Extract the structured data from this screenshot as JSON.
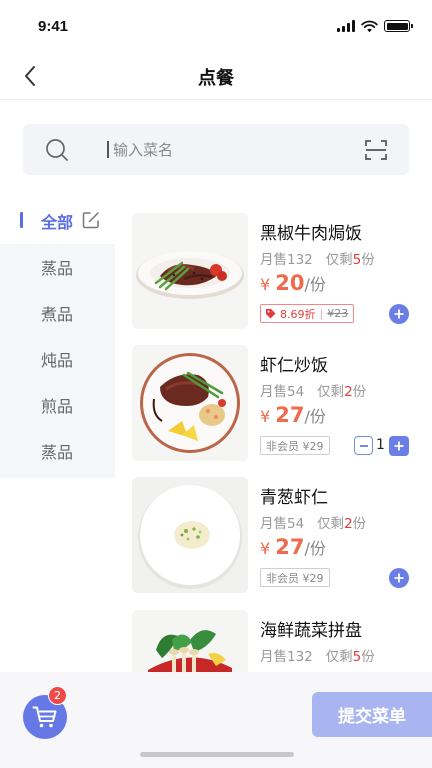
{
  "status_bar": {
    "time": "9:41"
  },
  "header": {
    "title": "点餐"
  },
  "search": {
    "placeholder": "输入菜名",
    "value": ""
  },
  "categories": [
    {
      "label": "全部",
      "active": true
    },
    {
      "label": "蒸品",
      "active": false
    },
    {
      "label": "煮品",
      "active": false
    },
    {
      "label": "炖品",
      "active": false
    },
    {
      "label": "煎品",
      "active": false
    },
    {
      "label": "蒸品",
      "active": false
    }
  ],
  "dishes": [
    {
      "name": "黑椒牛肉焗饭",
      "sold_prefix": "月售",
      "sold": "132",
      "left_prefix": "仅剩",
      "left": "5",
      "left_suffix": "份",
      "yen": "¥",
      "price": "20",
      "unit": "/份",
      "discount": "8.69折",
      "orig_price": "¥23",
      "quantity": 0
    },
    {
      "name": "虾仁炒饭",
      "sold_prefix": "月售",
      "sold": "54",
      "left_prefix": "仅剩",
      "left": "2",
      "left_suffix": "份",
      "yen": "¥",
      "price": "27",
      "unit": "/份",
      "member_tag": "非会员 ¥29",
      "quantity": 1
    },
    {
      "name": "青葱虾仁",
      "sold_prefix": "月售",
      "sold": "54",
      "left_prefix": "仅剩",
      "left": "2",
      "left_suffix": "份",
      "yen": "¥",
      "price": "27",
      "unit": "/份",
      "member_tag": "非会员 ¥29",
      "quantity": 0
    },
    {
      "name": "海鲜蔬菜拼盘",
      "sold_prefix": "月售",
      "sold": "132",
      "left_prefix": "仅剩",
      "left": "5",
      "left_suffix": "份",
      "quantity": 0
    }
  ],
  "cart": {
    "badge": "2"
  },
  "submit": {
    "label": "提交菜单"
  },
  "colors": {
    "accent": "#5b6ee1",
    "price": "#ee6b4d",
    "stock_highlight": "#e23d3d",
    "submit_bg": "#a9b5f1"
  },
  "icons": [
    "back-arrow-icon",
    "search-icon",
    "scan-icon",
    "edit-icon",
    "plus-icon",
    "minus-icon",
    "cart-icon"
  ]
}
